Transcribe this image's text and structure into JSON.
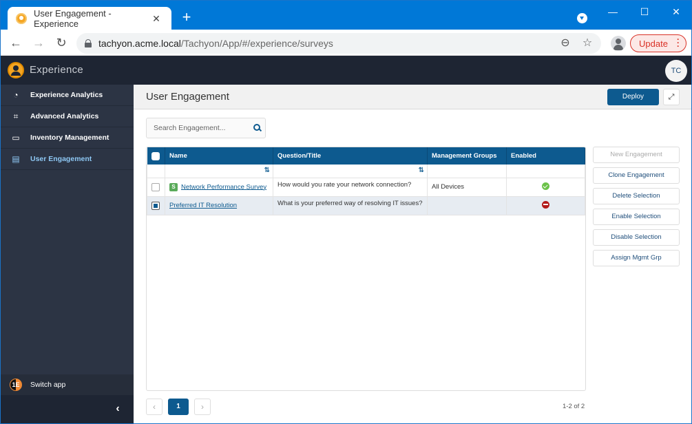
{
  "browser": {
    "tab_title": "User Engagement - Experience",
    "tab_close": "✕",
    "new_tab": "+",
    "url_host": "tachyon.acme.local",
    "url_path": "/Tachyon/App/#/experience/surveys",
    "update_label": "Update",
    "window_controls": {
      "minimize": "—",
      "maximize": "☐",
      "close": "✕"
    },
    "nav": {
      "back": "←",
      "forward": "→",
      "reload": "↻"
    },
    "omnibox_icons": {
      "zoom": "⊖",
      "bookmark": "☆"
    }
  },
  "app": {
    "name": "Experience",
    "user_initials": "TC"
  },
  "sidebar": {
    "items": [
      {
        "label": "Experience Analytics",
        "icon": "dashboard-icon",
        "glyph": "◔",
        "active": false
      },
      {
        "label": "Advanced Analytics",
        "icon": "binoculars-icon",
        "glyph": "⌗",
        "active": false
      },
      {
        "label": "Inventory Management",
        "icon": "monitor-icon",
        "glyph": "▭",
        "active": false
      },
      {
        "label": "User Engagement",
        "icon": "clipboard-icon",
        "glyph": "▤",
        "active": true
      }
    ],
    "switch_app": "Switch app",
    "switch_logo": "1E",
    "collapse": "‹"
  },
  "page": {
    "title": "User Engagement",
    "deploy_label": "Deploy",
    "expand_glyph": "⤢",
    "search_placeholder": "Search Engagement..."
  },
  "table": {
    "columns": [
      "Name",
      "Question/Title",
      "Management Groups",
      "Enabled"
    ],
    "sort_glyph": "⇅",
    "rows": [
      {
        "badge": "S",
        "name": "Network Performance Survey",
        "question": "How would you rate your network connection?",
        "groups": "All Devices",
        "enabled": true,
        "selected": false
      },
      {
        "badge": "",
        "name": "Preferred IT Resolution",
        "question": "What is your preferred way of resolving IT issues?",
        "groups": "",
        "enabled": false,
        "selected": true
      }
    ]
  },
  "actions": [
    {
      "label": "New Engagement",
      "disabled": true
    },
    {
      "label": "Clone Engagement",
      "disabled": false
    },
    {
      "label": "Delete Selection",
      "disabled": false
    },
    {
      "label": "Enable Selection",
      "disabled": false
    },
    {
      "label": "Disable Selection",
      "disabled": false
    },
    {
      "label": "Assign Mgmt Grp",
      "disabled": false
    }
  ],
  "pagination": {
    "prev": "‹",
    "current": "1",
    "next": "›",
    "summary": "1-2 of 2"
  }
}
